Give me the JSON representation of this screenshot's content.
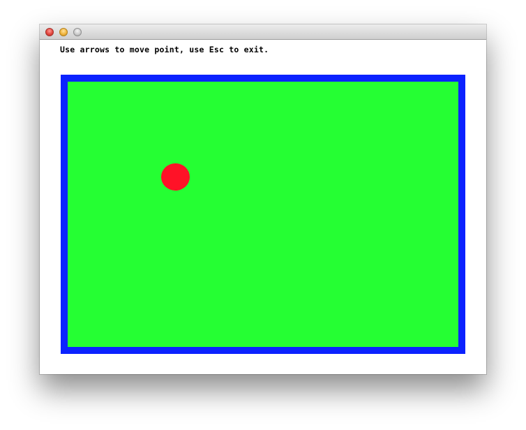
{
  "window": {
    "controls": {
      "close_icon": "close-traffic-light-icon",
      "minimize_icon": "minimize-traffic-light-icon",
      "zoom_icon": "zoom-traffic-light-icon"
    }
  },
  "instructions": {
    "text": "Use arrows to move point, use Esc to exit."
  },
  "colors": {
    "border": "#0b22ff",
    "field": "#25ff33",
    "point": "#ff1227"
  }
}
